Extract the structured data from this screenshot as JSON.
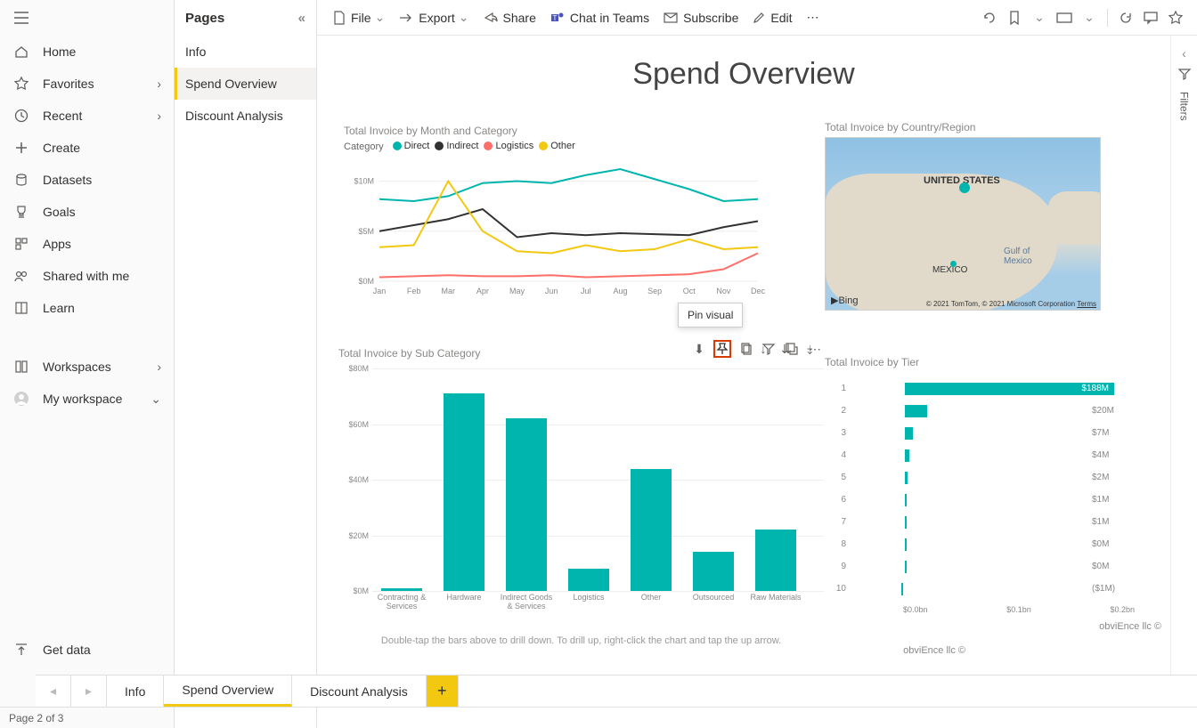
{
  "leftnav": {
    "items": [
      {
        "id": "home",
        "label": "Home",
        "expand": false
      },
      {
        "id": "favorites",
        "label": "Favorites",
        "expand": true
      },
      {
        "id": "recent",
        "label": "Recent",
        "expand": true
      },
      {
        "id": "create",
        "label": "Create",
        "expand": false
      },
      {
        "id": "datasets",
        "label": "Datasets",
        "expand": false
      },
      {
        "id": "goals",
        "label": "Goals",
        "expand": false
      },
      {
        "id": "apps",
        "label": "Apps",
        "expand": false
      },
      {
        "id": "shared",
        "label": "Shared with me",
        "expand": false
      },
      {
        "id": "learn",
        "label": "Learn",
        "expand": false
      }
    ],
    "workspaces_label": "Workspaces",
    "myworkspace_label": "My workspace",
    "getdata_label": "Get data"
  },
  "pages_pane": {
    "title": "Pages",
    "items": [
      "Info",
      "Spend Overview",
      "Discount Analysis"
    ],
    "selected": 1
  },
  "toolbar": {
    "file": "File",
    "export": "Export",
    "share": "Share",
    "chat": "Chat in Teams",
    "subscribe": "Subscribe",
    "edit": "Edit"
  },
  "filters_label": "Filters",
  "report": {
    "title": "Spend Overview",
    "copyright": "obviEnce llc ©"
  },
  "tooltip": {
    "pin": "Pin visual"
  },
  "line_chart": {
    "title": "Total Invoice by Month and Category",
    "legend_label": "Category",
    "legend": [
      {
        "name": "Direct",
        "color": "#00b5ad"
      },
      {
        "name": "Indirect",
        "color": "#323232"
      },
      {
        "name": "Logistics",
        "color": "#ff6f69"
      },
      {
        "name": "Other",
        "color": "#f2c811"
      }
    ],
    "yticks": [
      "$10M",
      "$5M",
      "$0M"
    ],
    "xlabels": [
      "Jan",
      "Feb",
      "Mar",
      "Apr",
      "May",
      "Jun",
      "Jul",
      "Aug",
      "Sep",
      "Oct",
      "Nov",
      "Dec"
    ]
  },
  "map": {
    "title": "Total Invoice by Country/Region",
    "country_label": "UNITED STATES",
    "mexico_label": "MEXICO",
    "gulf_label": "Gulf of\nMexico",
    "attribution": "Bing",
    "credits": "© 2021 TomTom, © 2021 Microsoft Corporation",
    "terms": "Terms"
  },
  "bar_chart": {
    "title": "Total Invoice by Sub Category",
    "yticks": [
      "$80M",
      "$60M",
      "$40M",
      "$20M",
      "$0M"
    ],
    "hint": "Double-tap the bars above to drill down. To drill up, right-click the chart and tap the up arrow."
  },
  "tier_chart": {
    "title": "Total Invoice by Tier",
    "xticks": [
      "$0.0bn",
      "$0.1bn",
      "$0.2bn"
    ]
  },
  "tabs": {
    "items": [
      "Info",
      "Spend Overview",
      "Discount Analysis"
    ],
    "active": 1
  },
  "status": {
    "page": "Page 2 of 3"
  },
  "chart_data": [
    {
      "type": "line",
      "title": "Total Invoice by Month and Category",
      "xlabel": "Month",
      "ylabel": "Total Invoice",
      "categories": [
        "Jan",
        "Feb",
        "Mar",
        "Apr",
        "May",
        "Jun",
        "Jul",
        "Aug",
        "Sep",
        "Oct",
        "Nov",
        "Dec"
      ],
      "series": [
        {
          "name": "Direct",
          "color": "#00b5ad",
          "values": [
            8.2,
            8.0,
            8.5,
            9.8,
            10.0,
            9.8,
            10.6,
            11.2,
            10.2,
            9.2,
            8.0,
            8.2
          ]
        },
        {
          "name": "Indirect",
          "color": "#323232",
          "values": [
            5.0,
            5.6,
            6.2,
            7.2,
            4.4,
            4.8,
            4.6,
            4.8,
            4.7,
            4.6,
            5.4,
            6.0
          ]
        },
        {
          "name": "Logistics",
          "color": "#ff6f69",
          "values": [
            0.4,
            0.5,
            0.6,
            0.5,
            0.5,
            0.6,
            0.4,
            0.5,
            0.6,
            0.7,
            1.2,
            2.8
          ]
        },
        {
          "name": "Other",
          "color": "#f2c811",
          "values": [
            3.4,
            3.6,
            10.0,
            5.0,
            3.0,
            2.8,
            3.6,
            3.0,
            3.2,
            4.2,
            3.2,
            3.4
          ]
        }
      ],
      "ylim": [
        0,
        12
      ],
      "yunit": "$M"
    },
    {
      "type": "bar",
      "title": "Total Invoice by Sub Category",
      "categories": [
        "Contracting & Services",
        "Hardware",
        "Indirect Goods & Services",
        "Logistics",
        "Other",
        "Outsourced",
        "Raw Materials"
      ],
      "values": [
        1,
        71,
        62,
        8,
        44,
        14,
        22
      ],
      "ylim": [
        0,
        80
      ],
      "yunit": "$M"
    },
    {
      "type": "bar_horizontal",
      "title": "Total Invoice by Tier",
      "categories": [
        "1",
        "2",
        "3",
        "4",
        "5",
        "6",
        "7",
        "8",
        "9",
        "10"
      ],
      "values": [
        188,
        20,
        7,
        4,
        2,
        1,
        1,
        0.05,
        0.05,
        -1
      ],
      "labels": [
        "$188M",
        "$20M",
        "$7M",
        "$4M",
        "$2M",
        "$1M",
        "$1M",
        "$0M",
        "$0M",
        "($1M)"
      ],
      "xlim": [
        0,
        200
      ],
      "xunit": "$M"
    },
    {
      "type": "map",
      "title": "Total Invoice by Country/Region",
      "points": [
        {
          "name": "United States",
          "lat": 40,
          "lon": -83,
          "size": 12
        },
        {
          "name": "Mexico",
          "lat": 22,
          "lon": -101,
          "size": 6
        }
      ]
    }
  ]
}
